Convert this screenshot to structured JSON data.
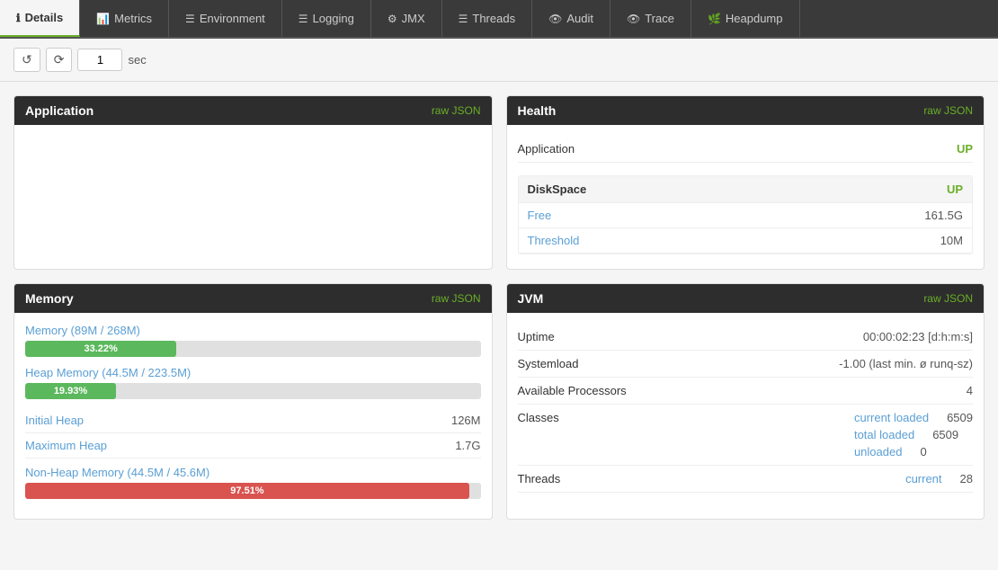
{
  "tabs": [
    {
      "id": "details",
      "label": "Details",
      "icon": "ℹ",
      "active": true
    },
    {
      "id": "metrics",
      "label": "Metrics",
      "icon": "📊",
      "active": false
    },
    {
      "id": "environment",
      "label": "Environment",
      "icon": "☰",
      "active": false
    },
    {
      "id": "logging",
      "label": "Logging",
      "icon": "☰",
      "active": false
    },
    {
      "id": "jmx",
      "label": "JMX",
      "icon": "⚙",
      "active": false
    },
    {
      "id": "threads",
      "label": "Threads",
      "icon": "☰",
      "active": false
    },
    {
      "id": "audit",
      "label": "Audit",
      "icon": "👁",
      "active": false
    },
    {
      "id": "trace",
      "label": "Trace",
      "icon": "👁",
      "active": false
    },
    {
      "id": "heapdump",
      "label": "Heapdump",
      "icon": "🌿",
      "active": false
    }
  ],
  "toolbar": {
    "refresh_icon": "↺",
    "auto_refresh_icon": "⟳",
    "interval_value": "1",
    "interval_unit": "sec"
  },
  "application_card": {
    "title": "Application",
    "raw_json_label": "raw JSON"
  },
  "health_card": {
    "title": "Health",
    "raw_json_label": "raw JSON",
    "application_label": "Application",
    "application_status": "UP",
    "diskspace_label": "DiskSpace",
    "diskspace_status": "UP",
    "free_label": "Free",
    "free_value": "161.5G",
    "threshold_label": "Threshold",
    "threshold_value": "10M"
  },
  "memory_card": {
    "title": "Memory",
    "raw_json_label": "raw JSON",
    "memory_label": "Memory (89M / 268M)",
    "memory_percent": "33.22%",
    "memory_bar_width": "33.22",
    "memory_bar_color": "green",
    "heap_label": "Heap Memory (44.5M / 223.5M)",
    "heap_percent": "19.93%",
    "heap_bar_width": "19.93",
    "heap_bar_color": "green",
    "initial_heap_label": "Initial Heap",
    "initial_heap_value": "126M",
    "maximum_heap_label": "Maximum Heap",
    "maximum_heap_value": "1.7G",
    "nonheap_label": "Non-Heap Memory (44.5M / 45.6M)",
    "nonheap_percent": "97.51%",
    "nonheap_bar_width": "97.51",
    "nonheap_bar_color": "red"
  },
  "jvm_card": {
    "title": "JVM",
    "raw_json_label": "raw JSON",
    "uptime_label": "Uptime",
    "uptime_value": "00:00:02:23 [d:h:m:s]",
    "systemload_label": "Systemload",
    "systemload_value": "-1.00 (last min. ø runq-sz)",
    "processors_label": "Available Processors",
    "processors_value": "4",
    "classes_label": "Classes",
    "current_loaded_label": "current loaded",
    "current_loaded_value": "6509",
    "total_loaded_label": "total loaded",
    "total_loaded_value": "6509",
    "unloaded_label": "unloaded",
    "unloaded_value": "0",
    "threads_label": "Threads",
    "threads_current_label": "current",
    "threads_current_value": "28"
  }
}
